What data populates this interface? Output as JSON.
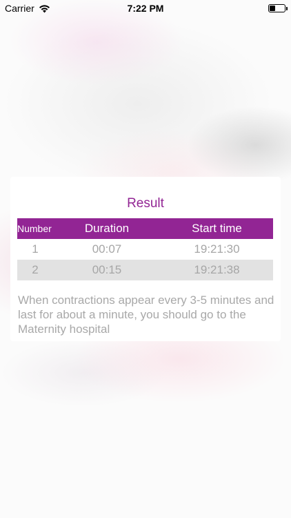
{
  "status_bar": {
    "carrier": "Carrier",
    "time": "7:22 PM",
    "battery_level": 0.4
  },
  "result": {
    "title": "Result",
    "columns": [
      "Number",
      "Duration",
      "Start time"
    ],
    "rows": [
      {
        "number": "1",
        "duration": "00:07",
        "start_time": "19:21:30"
      },
      {
        "number": "2",
        "duration": "00:15",
        "start_time": "19:21:38"
      }
    ],
    "note": "When contractions appear every 3-5 minutes and last for about a minute, you should go to the Maternity hospital"
  },
  "colors": {
    "accent": "#922594",
    "text_muted": "#a6a6a6",
    "row_alt": "#e2e2e2"
  }
}
